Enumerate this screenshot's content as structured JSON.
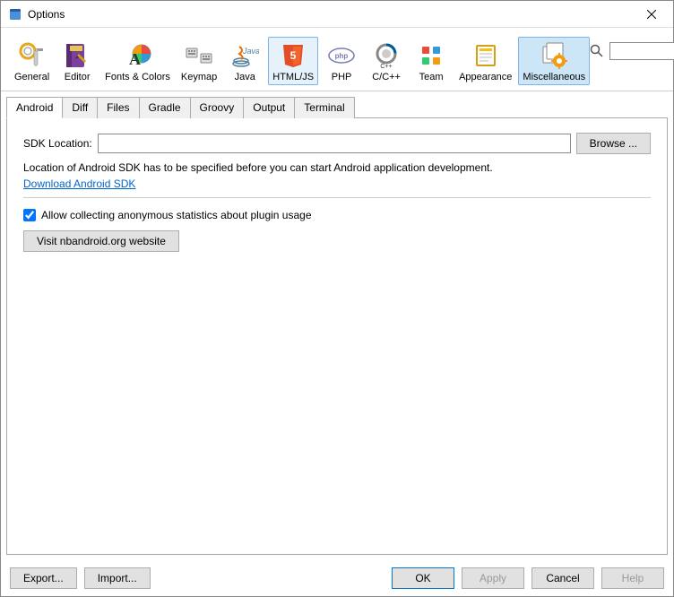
{
  "window": {
    "title": "Options"
  },
  "toolbar": {
    "items": [
      {
        "label": "General",
        "icon": "general"
      },
      {
        "label": "Editor",
        "icon": "editor"
      },
      {
        "label": "Fonts & Colors",
        "icon": "fonts"
      },
      {
        "label": "Keymap",
        "icon": "keymap"
      },
      {
        "label": "Java",
        "icon": "java"
      },
      {
        "label": "HTML/JS",
        "icon": "htmljs"
      },
      {
        "label": "PHP",
        "icon": "php"
      },
      {
        "label": "C/C++",
        "icon": "cpp"
      },
      {
        "label": "Team",
        "icon": "team"
      },
      {
        "label": "Appearance",
        "icon": "appearance"
      },
      {
        "label": "Miscellaneous",
        "icon": "misc"
      }
    ],
    "selected": "Miscellaneous"
  },
  "search": {
    "value": ""
  },
  "tabs": {
    "items": [
      "Android",
      "Diff",
      "Files",
      "Gradle",
      "Groovy",
      "Output",
      "Terminal"
    ],
    "active": "Android"
  },
  "panel": {
    "sdkLocationLabel": "SDK Location:",
    "sdkLocationValue": "",
    "browseLabel": "Browse ...",
    "infoText": "Location of Android SDK has to be specified before you can start Android application development.",
    "downloadLink": "Download Android SDK",
    "checkboxLabel": "Allow collecting anonymous statistics about plugin usage",
    "checkboxChecked": true,
    "visitButton": "Visit nbandroid.org website"
  },
  "buttons": {
    "export": "Export...",
    "import": "Import...",
    "ok": "OK",
    "apply": "Apply",
    "cancel": "Cancel",
    "help": "Help"
  }
}
